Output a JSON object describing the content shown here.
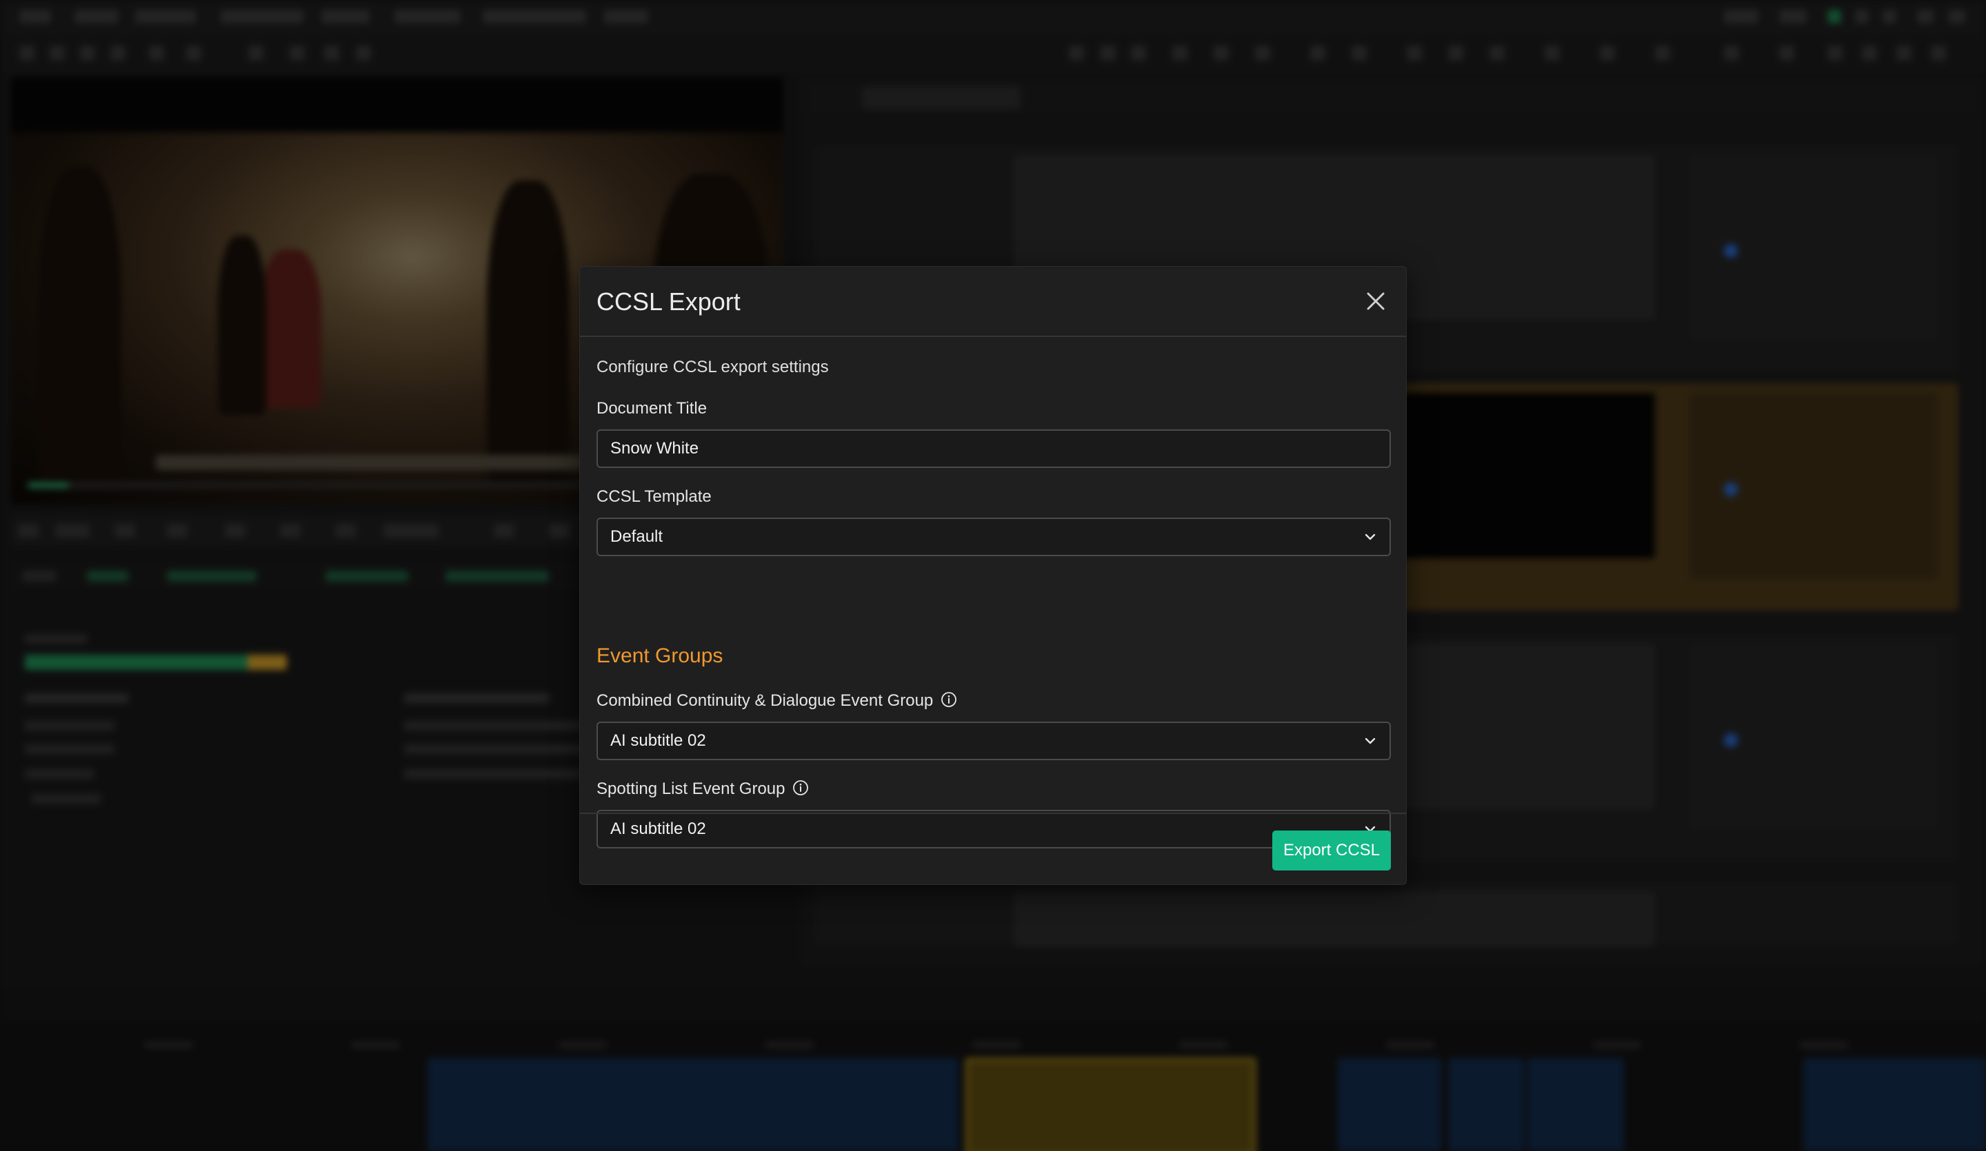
{
  "modal": {
    "title": "CCSL Export",
    "subtitle": "Configure CCSL export settings",
    "document_title": {
      "label": "Document Title",
      "value": "Snow White"
    },
    "template": {
      "label": "CCSL Template",
      "selected": "Default"
    },
    "event_groups": {
      "heading": "Event Groups",
      "combined": {
        "label": "Combined Continuity & Dialogue Event Group",
        "selected": "AI subtitle 02"
      },
      "spotting": {
        "label": "Spotting List Event Group",
        "selected": "AI subtitle 02"
      }
    },
    "export_button": "Export CCSL"
  },
  "colors": {
    "accent_orange": "#f0982e",
    "export_green": "#12b886",
    "modal_bg": "#1f1f1f"
  },
  "icons": {
    "close": "close-icon",
    "info": "info-icon",
    "chevron": "chevron-down-icon"
  }
}
